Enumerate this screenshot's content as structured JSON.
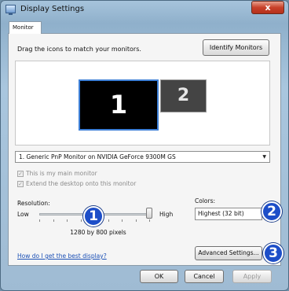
{
  "window": {
    "title": "Display Settings",
    "close_label": "x"
  },
  "tabs": [
    {
      "label": "Monitor",
      "selected": true
    }
  ],
  "instruction": "Drag the icons to match your monitors.",
  "identify_button": "Identify Monitors",
  "monitors": [
    {
      "number": "1",
      "selected": true
    },
    {
      "number": "2",
      "selected": false
    }
  ],
  "display_select": {
    "value": "1. Generic PnP Monitor on NVIDIA GeForce 9300M GS"
  },
  "checkboxes": [
    {
      "label": "This is my main monitor",
      "checked": true,
      "enabled": false
    },
    {
      "label": "Extend the desktop onto this monitor",
      "checked": true,
      "enabled": false
    }
  ],
  "resolution": {
    "label": "Resolution:",
    "low": "Low",
    "high": "High",
    "value_text": "1280 by 800 pixels",
    "level": 1.0
  },
  "colors": {
    "label": "Colors:",
    "value": "Highest (32 bit)"
  },
  "help_link": "How do I get the best display?",
  "advanced_button": "Advanced Settings...",
  "footer": {
    "ok": "OK",
    "cancel": "Cancel",
    "apply": "Apply"
  },
  "badges": [
    "1",
    "2",
    "3"
  ],
  "colors_theme": {
    "accent": "#1d4ec8",
    "link": "#1a4fb5",
    "close": "#c8412a"
  }
}
